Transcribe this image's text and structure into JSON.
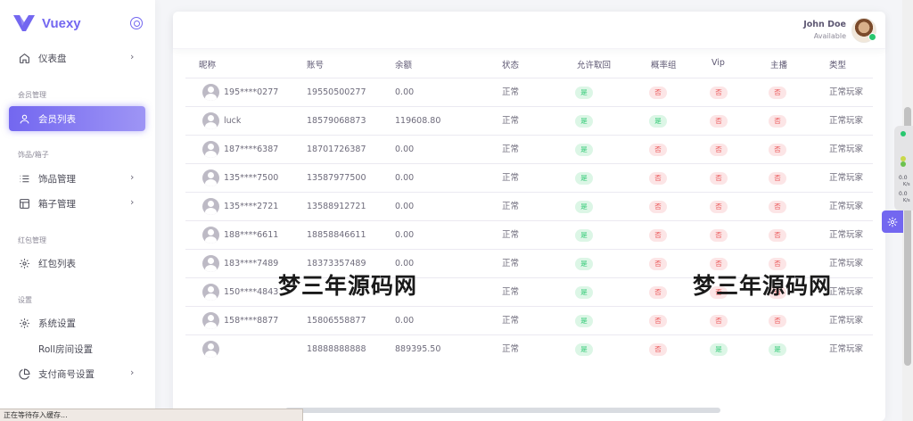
{
  "app": {
    "name": "Vuexy"
  },
  "sidebar": {
    "items": [
      {
        "type": "item",
        "label": "仪表盘",
        "icon": "home-icon",
        "chevron": true
      },
      {
        "type": "section",
        "label": "会员管理"
      },
      {
        "type": "item",
        "label": "会员列表",
        "icon": "user-icon",
        "chevron": false,
        "active": true
      },
      {
        "type": "section",
        "label": "饰品/箱子"
      },
      {
        "type": "item",
        "label": "饰品管理",
        "icon": "list-icon",
        "chevron": true
      },
      {
        "type": "item",
        "label": "箱子管理",
        "icon": "layout-icon",
        "chevron": true
      },
      {
        "type": "section",
        "label": "红包管理"
      },
      {
        "type": "item",
        "label": "红包列表",
        "icon": "gear-icon",
        "chevron": false
      },
      {
        "type": "section",
        "label": "设置"
      },
      {
        "type": "item",
        "label": "系统设置",
        "icon": "gear-icon",
        "chevron": false
      },
      {
        "type": "item",
        "label": "Roll房间设置",
        "icon": "",
        "chevron": false
      },
      {
        "type": "item",
        "label": "支付商号设置",
        "icon": "pie-chart-icon",
        "chevron": true
      }
    ]
  },
  "header": {
    "user_name": "John Doe",
    "user_status": "Available"
  },
  "table": {
    "columns": [
      "昵称",
      "账号",
      "余额",
      "状态",
      "允许取回",
      "概率组",
      "Vip",
      "主播",
      "类型"
    ],
    "rows": [
      {
        "nickname": "195****0277",
        "account": "19550500277",
        "balance": "0.00",
        "status": "正常",
        "allow": "是",
        "prob": "否",
        "vip": "否",
        "anchor": "否",
        "type": "正常玩家"
      },
      {
        "nickname": "luck",
        "account": "18579068873",
        "balance": "119608.80",
        "status": "正常",
        "allow": "是",
        "prob": "是",
        "vip": "否",
        "anchor": "否",
        "type": "正常玩家"
      },
      {
        "nickname": "187****6387",
        "account": "18701726387",
        "balance": "0.00",
        "status": "正常",
        "allow": "是",
        "prob": "否",
        "vip": "否",
        "anchor": "否",
        "type": "正常玩家"
      },
      {
        "nickname": "135****7500",
        "account": "13587977500",
        "balance": "0.00",
        "status": "正常",
        "allow": "是",
        "prob": "否",
        "vip": "否",
        "anchor": "否",
        "type": "正常玩家"
      },
      {
        "nickname": "135****2721",
        "account": "13588912721",
        "balance": "0.00",
        "status": "正常",
        "allow": "是",
        "prob": "否",
        "vip": "否",
        "anchor": "否",
        "type": "正常玩家"
      },
      {
        "nickname": "188****6611",
        "account": "18858846611",
        "balance": "0.00",
        "status": "正常",
        "allow": "是",
        "prob": "否",
        "vip": "否",
        "anchor": "否",
        "type": "正常玩家"
      },
      {
        "nickname": "183****7489",
        "account": "18373357489",
        "balance": "0.00",
        "status": "正常",
        "allow": "是",
        "prob": "否",
        "vip": "否",
        "anchor": "否",
        "type": "正常玩家"
      },
      {
        "nickname": "150****4843",
        "account": "",
        "balance": "",
        "status": "正常",
        "allow": "是",
        "prob": "否",
        "vip": "否",
        "anchor": "否",
        "type": "正常玩家"
      },
      {
        "nickname": "158****8877",
        "account": "15806558877",
        "balance": "0.00",
        "status": "正常",
        "allow": "是",
        "prob": "否",
        "vip": "否",
        "anchor": "否",
        "type": "正常玩家"
      },
      {
        "nickname": "",
        "account": "18888888888",
        "balance": "889395.50",
        "status": "正常",
        "allow": "是",
        "prob": "否",
        "vip": "是",
        "anchor": "是",
        "type": "正常玩家"
      }
    ]
  },
  "watermark": {
    "left": "梦三年源码网",
    "right": "梦三年源码网"
  },
  "side_tools": {
    "num1": "0.0",
    "unit1": "K/s",
    "num2": "0.0",
    "unit2": "K/s"
  },
  "status_bar": "正在等待存入缓存...",
  "colors": {
    "accent": "#7367f0",
    "success": "#28c76f",
    "danger": "#ea5455"
  }
}
